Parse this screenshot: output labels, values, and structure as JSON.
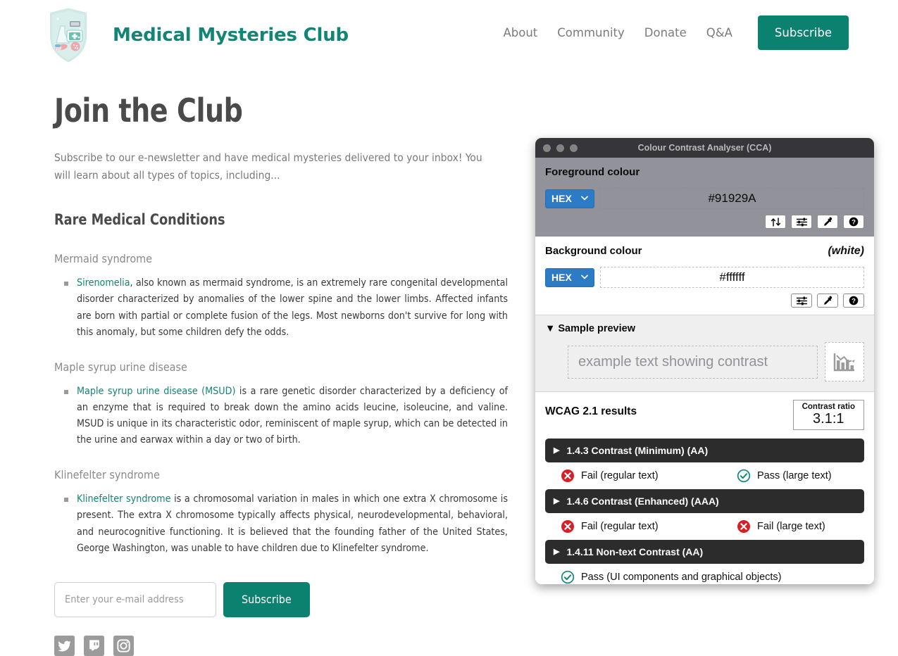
{
  "site": {
    "brand_title": "Medical Mysteries Club",
    "logo_icon": "medical-shield-logo",
    "nav": [
      {
        "label": "About"
      },
      {
        "label": "Community"
      },
      {
        "label": "Donate"
      },
      {
        "label": "Q&A"
      }
    ],
    "nav_subscribe_label": "Subscribe",
    "accent_color": "#0b8270",
    "brand_color": "#128577"
  },
  "main": {
    "page_title": "Join the Club",
    "intro": "Subscribe to our e-newsletter and have medical mysteries delivered to your inbox! You will learn about all types of topics, including...",
    "section_title": "Rare Medical Conditions",
    "conditions": [
      {
        "heading": "Mermaid syndrome",
        "link_text": "Sirenomelia",
        "body": ", also known as mermaid syndrome, is an extremely rare congenital developmental disorder characterized by anomalies of the lower spine and the lower limbs. Affected infants are born with partial or complete fusion of the legs. Most newborns don't survive for long with this anomaly, but some children defy the odds."
      },
      {
        "heading": "Maple syrup urine disease",
        "link_text": "Maple syrup urine disease (MSUD)",
        "body": " is a rare genetic disorder characterized by a deficiency of an enzyme that is required to break down the amino acids leucine, isoleucine, and valine. MSUD is unique in its characteristic odor, reminiscent of maple syrup, which can be detected in the urine and earwax within a day or two of birth."
      },
      {
        "heading": "Klinefelter syndrome",
        "link_text": "Klinefelter syndrome",
        "body": " is a chromosomal variation in males in which one extra X chromosome is present. The extra X chromosome typically affects physical, neurodevelopmental, behavioral, and neurocognitive functioning. It is believed that the founding father of the United States, George Washington, was unable to have children due to Klinefelter syndrome."
      }
    ],
    "form": {
      "email_placeholder": "Enter your e-mail address",
      "email_value": "",
      "submit_label": "Subscribe"
    },
    "socials": [
      {
        "icon": "twitter-icon"
      },
      {
        "icon": "twitch-icon"
      },
      {
        "icon": "instagram-icon"
      }
    ]
  },
  "cca": {
    "window_title": "Colour Contrast Analyser (CCA)",
    "foreground": {
      "label": "Foreground colour",
      "format": "HEX",
      "value": "#91929A",
      "buttons": [
        "swap-colours-icon",
        "sliders-icon",
        "eyedropper-icon",
        "help-icon"
      ]
    },
    "background": {
      "label": "Background colour",
      "note": "(white)",
      "format": "HEX",
      "value": "#ffffff",
      "buttons": [
        "sliders-icon",
        "eyedropper-icon",
        "help-icon"
      ]
    },
    "preview": {
      "header": "Sample preview",
      "expanded": true,
      "sample_text": "example text showing contrast",
      "chart_icon": "declining-bar-chart-icon"
    },
    "results": {
      "title": "WCAG 2.1 results",
      "ratio_label": "Contrast ratio",
      "ratio_value": "3.1:1",
      "criteria": [
        {
          "name": "1.4.3 Contrast (Minimum) (AA)",
          "expanded": false,
          "results": [
            {
              "status": "fail",
              "label": "Fail (regular text)"
            },
            {
              "status": "pass",
              "label": "Pass (large text)"
            }
          ]
        },
        {
          "name": "1.4.6 Contrast (Enhanced) (AAA)",
          "expanded": false,
          "results": [
            {
              "status": "fail",
              "label": "Fail (regular text)"
            },
            {
              "status": "fail",
              "label": "Fail (large text)"
            }
          ]
        },
        {
          "name": "1.4.11 Non-text Contrast (AA)",
          "expanded": false,
          "results": [
            {
              "status": "pass",
              "label": "Pass (UI components and graphical objects)"
            }
          ]
        }
      ]
    },
    "colors": {
      "fail": "#d81f28",
      "pass": "#0e8a7d",
      "select": "#2b7cc4"
    }
  }
}
